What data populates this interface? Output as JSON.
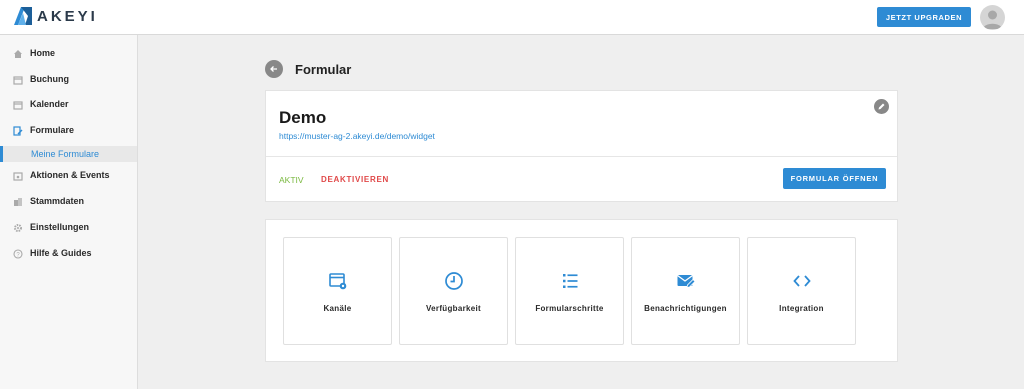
{
  "header": {
    "logo_text": "AKEYI",
    "upgrade_label": "JETZT UPGRADEN"
  },
  "sidebar": {
    "items": [
      {
        "label": "Home",
        "icon": "home-icon"
      },
      {
        "label": "Buchung",
        "icon": "calendar-icon"
      },
      {
        "label": "Kalender",
        "icon": "calendar-icon"
      },
      {
        "label": "Formulare",
        "icon": "form-edit-icon"
      },
      {
        "label": "Aktionen & Events",
        "icon": "calendar-star-icon"
      },
      {
        "label": "Stammdaten",
        "icon": "building-icon"
      },
      {
        "label": "Einstellungen",
        "icon": "gear-icon"
      },
      {
        "label": "Hilfe & Guides",
        "icon": "help-icon"
      }
    ],
    "sub_item": "Meine Formulare"
  },
  "page": {
    "title": "Formular"
  },
  "form": {
    "name": "Demo",
    "url": "https://muster-ag-2.akeyi.de/demo/widget",
    "status": "AKTIV",
    "deactivate_label": "DEAKTIVIEREN",
    "open_label": "FORMULAR ÖFFNEN"
  },
  "tiles": [
    {
      "label": "Kanäle",
      "icon": "window-gear-icon"
    },
    {
      "label": "Verfügbarkeit",
      "icon": "clock-icon"
    },
    {
      "label": "Formularschritte",
      "icon": "list-icon"
    },
    {
      "label": "Benachrichtigungen",
      "icon": "mail-edit-icon"
    },
    {
      "label": "Integration",
      "icon": "code-icon"
    }
  ],
  "colors": {
    "accent": "#2e8bd4",
    "active_status": "#7ab940",
    "danger": "#e04848"
  }
}
